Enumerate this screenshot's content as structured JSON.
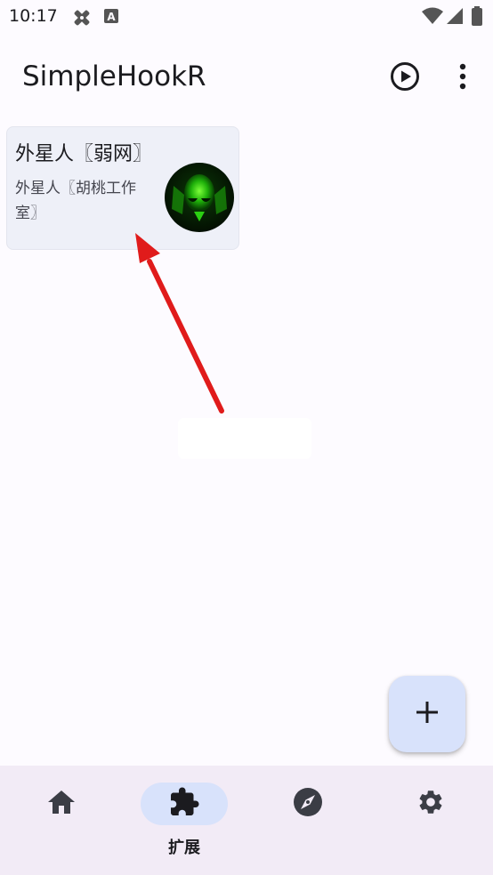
{
  "status_bar": {
    "time": "10:17",
    "icons": [
      "notification-icon",
      "a-badge-icon",
      "wifi-icon",
      "signal-icon",
      "battery-icon"
    ]
  },
  "app_bar": {
    "title": "SimpleHookR",
    "actions": [
      "play-icon",
      "more-vert-icon"
    ]
  },
  "extensions": [
    {
      "title": "外星人〖弱网〗",
      "subtitle": "外星人〖胡桃工作室〗",
      "avatar": "alien-head-green"
    }
  ],
  "fab": {
    "icon": "plus-icon"
  },
  "bottom_nav": {
    "items": [
      {
        "id": "home",
        "icon": "home-icon",
        "label": "",
        "active": false
      },
      {
        "id": "extensions",
        "icon": "puzzle-icon",
        "label": "扩展",
        "active": true
      },
      {
        "id": "discover",
        "icon": "compass-icon",
        "label": "",
        "active": false
      },
      {
        "id": "settings",
        "icon": "gear-icon",
        "label": "",
        "active": false
      }
    ]
  },
  "colors": {
    "background": "#fdfbff",
    "card": "#eef0f8",
    "accent_container": "#d8e2fb",
    "nav_bar": "#f2ebf6",
    "annotation_arrow": "#e01b1b"
  }
}
